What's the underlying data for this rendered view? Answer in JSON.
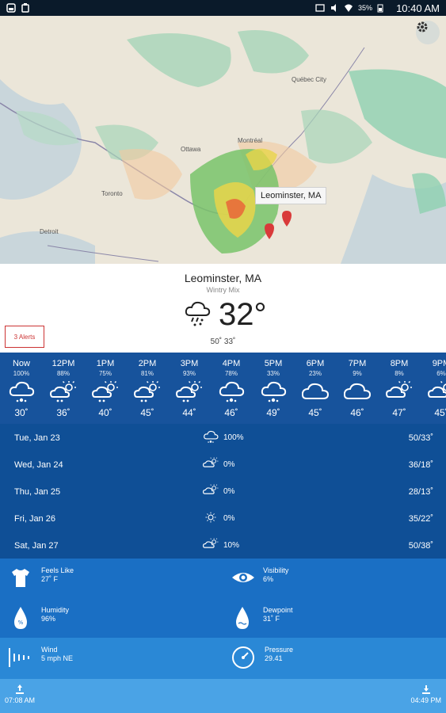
{
  "status_bar": {
    "time": "10:40 AM",
    "battery": "35%",
    "icons": [
      "notification-icon",
      "clipboard-icon",
      "cast-icon",
      "mute-icon",
      "wifi-icon",
      "battery-icon"
    ]
  },
  "map": {
    "selected_label": "Leominster, MA",
    "cities": [
      "Québec City",
      "Montréal",
      "Ottawa",
      "Toronto",
      "Detroit"
    ],
    "settings_icon": "gear-icon"
  },
  "current": {
    "location": "Leominster, MA",
    "condition": "Wintry Mix",
    "temperature": "32°",
    "hilo": "50˚ 33˚",
    "alerts_label": "3 Alerts",
    "icon": "rain-snow-cloud-icon"
  },
  "hourly": [
    {
      "time": "Now",
      "pct": "100%",
      "temp": "30˚",
      "icon": "rain-cloud-icon"
    },
    {
      "time": "12PM",
      "pct": "88%",
      "temp": "36˚",
      "icon": "partly-sunny-rain-icon"
    },
    {
      "time": "1PM",
      "pct": "75%",
      "temp": "40˚",
      "icon": "partly-sunny-rain-icon"
    },
    {
      "time": "2PM",
      "pct": "81%",
      "temp": "45˚",
      "icon": "partly-sunny-rain-icon"
    },
    {
      "time": "3PM",
      "pct": "93%",
      "temp": "44˚",
      "icon": "partly-sunny-rain-icon"
    },
    {
      "time": "4PM",
      "pct": "78%",
      "temp": "46˚",
      "icon": "rain-cloud-icon"
    },
    {
      "time": "5PM",
      "pct": "33%",
      "temp": "49˚",
      "icon": "rain-cloud-icon"
    },
    {
      "time": "6PM",
      "pct": "23%",
      "temp": "45˚",
      "icon": "cloud-icon"
    },
    {
      "time": "7PM",
      "pct": "9%",
      "temp": "46˚",
      "icon": "cloud-icon"
    },
    {
      "time": "8PM",
      "pct": "8%",
      "temp": "47˚",
      "icon": "partly-sunny-icon"
    },
    {
      "time": "9PM",
      "pct": "6%",
      "temp": "45˚",
      "icon": "partly-sunny-icon"
    }
  ],
  "daily": [
    {
      "date": "Tue, Jan 23",
      "pct": "100%",
      "hilo": "50/33˚",
      "icon": "rain-cloud-icon"
    },
    {
      "date": "Wed, Jan 24",
      "pct": "0%",
      "hilo": "36/18˚",
      "icon": "partly-sunny-icon"
    },
    {
      "date": "Thu, Jan 25",
      "pct": "0%",
      "hilo": "28/13˚",
      "icon": "partly-sunny-icon"
    },
    {
      "date": "Fri, Jan 26",
      "pct": "0%",
      "hilo": "35/22˚",
      "icon": "sun-icon"
    },
    {
      "date": "Sat, Jan 27",
      "pct": "10%",
      "hilo": "50/38˚",
      "icon": "partly-sunny-icon"
    }
  ],
  "details": {
    "feels_like": {
      "label": "Feels Like",
      "value": "27˚ F",
      "icon": "tshirt-icon"
    },
    "visibility": {
      "label": "Visibility",
      "value": "6%",
      "icon": "eye-icon"
    },
    "humidity": {
      "label": "Humidity",
      "value": "96%",
      "icon": "humidity-drop-icon"
    },
    "dewpoint": {
      "label": "Dewpoint",
      "value": "31˚ F",
      "icon": "dewpoint-drop-icon"
    },
    "wind": {
      "label": "Wind",
      "value": "5 mph NE",
      "icon": "wind-icon"
    },
    "pressure": {
      "label": "Pressure",
      "value": "29.41",
      "icon": "gauge-icon"
    }
  },
  "sun": {
    "sunrise": "07:08 AM",
    "sunset": "04:49 PM",
    "sunrise_icon": "sunrise-icon",
    "sunset_icon": "sunset-icon"
  },
  "colors": {
    "hourly_bg": "#17539c",
    "daily_bg": "#0f4f96",
    "details_bg": "#1a6fc4",
    "details2_bg": "#2a88d6",
    "sunbar_bg": "#4aa3e6",
    "alert": "#cc3333"
  }
}
